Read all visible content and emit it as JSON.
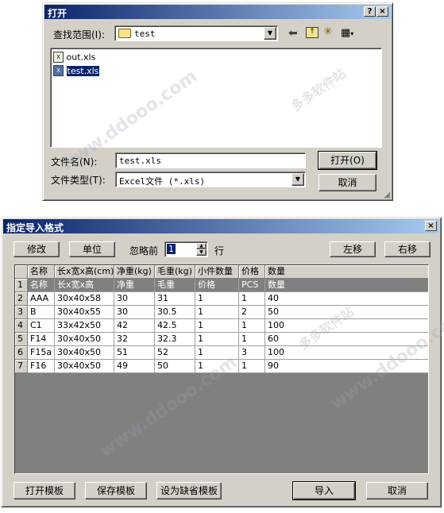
{
  "open_dialog": {
    "title": "打开",
    "help_btn": "?",
    "close_btn": "×",
    "lookin_label": "查找范围(I):",
    "lookin_value": "test",
    "files": [
      {
        "name": "out.xls"
      },
      {
        "name": "test.xls",
        "selected": true
      }
    ],
    "filename_label": "文件名(N):",
    "filename_value": "test.xls",
    "filetype_label": "文件类型(T):",
    "filetype_value": "Excel文件 (*.xls)",
    "open_button": "打开(O)",
    "cancel_button": "取消"
  },
  "import_dialog": {
    "title": "指定导入格式",
    "close_btn": "×",
    "toolbar": {
      "modify": "修改",
      "unit": "单位",
      "ignore_label": "忽略前",
      "ignore_value": "1",
      "rows_label": "行",
      "move_left": "左移",
      "move_right": "右移"
    },
    "table": {
      "headers": [
        "",
        "名称",
        "长x宽x高(cm)",
        "净重(kg)",
        "毛重(kg)",
        "小件数量",
        "价格",
        "数量"
      ],
      "rows": [
        [
          "1",
          "名称",
          "长x宽x高",
          "净重",
          "毛重",
          "价格",
          "PCS",
          "数量"
        ],
        [
          "2",
          "AAA",
          "30x40x58",
          "30",
          "31",
          "1",
          "1",
          "40"
        ],
        [
          "3",
          "B",
          "30x40x55",
          "30",
          "30.5",
          "1",
          "2",
          "50"
        ],
        [
          "4",
          "C1",
          "33x42x50",
          "42",
          "42.5",
          "1",
          "1",
          "100"
        ],
        [
          "5",
          "F14",
          "30x40x50",
          "32",
          "32.3",
          "1",
          "1",
          "60"
        ],
        [
          "6",
          "F15a",
          "30x40x50",
          "51",
          "52",
          "1",
          "3",
          "100"
        ],
        [
          "7",
          "F16",
          "30x40x50",
          "49",
          "50",
          "1",
          "1",
          "90"
        ]
      ]
    },
    "footer": {
      "open_template": "打开模板",
      "save_template": "保存模板",
      "set_default": "设为缺省模板",
      "import": "导入",
      "cancel": "取消"
    }
  },
  "watermark": {
    "site": "www.ddooo.com",
    "name": "多多软件站"
  },
  "colors": {
    "title_start": "#0a246a",
    "title_end": "#a6caf0",
    "face": "#d4d0c8",
    "selection": "#0a246a"
  }
}
